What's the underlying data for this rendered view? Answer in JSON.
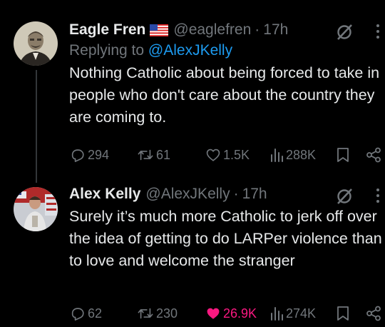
{
  "tweets": [
    {
      "name": "Eagle Fren",
      "handle": "@eaglefren",
      "separator": "·",
      "time": "17h",
      "reply_prefix": "Replying to",
      "reply_handle": "@AlexJKelly",
      "text": "Nothing Catholic about being forced to take in people who don't care about the country they are coming to.",
      "stats": {
        "replies": "294",
        "retweets": "61",
        "likes": "1.5K",
        "views": "288K"
      }
    },
    {
      "name": "Alex Kelly",
      "handle": "@AlexJKelly",
      "separator": "·",
      "time": "17h",
      "text": "Surely it’s much more Catholic to jerk off over the idea of getting to do LARPer violence than to love and welcome the stranger",
      "stats": {
        "replies": "62",
        "retweets": "230",
        "likes": "26.9K",
        "views": "274K"
      },
      "liked": true
    }
  ],
  "colors": {
    "background": "#000000",
    "text": "#e7e9ea",
    "muted": "#71767b",
    "link": "#1d9bf0",
    "like": "#f91880"
  }
}
